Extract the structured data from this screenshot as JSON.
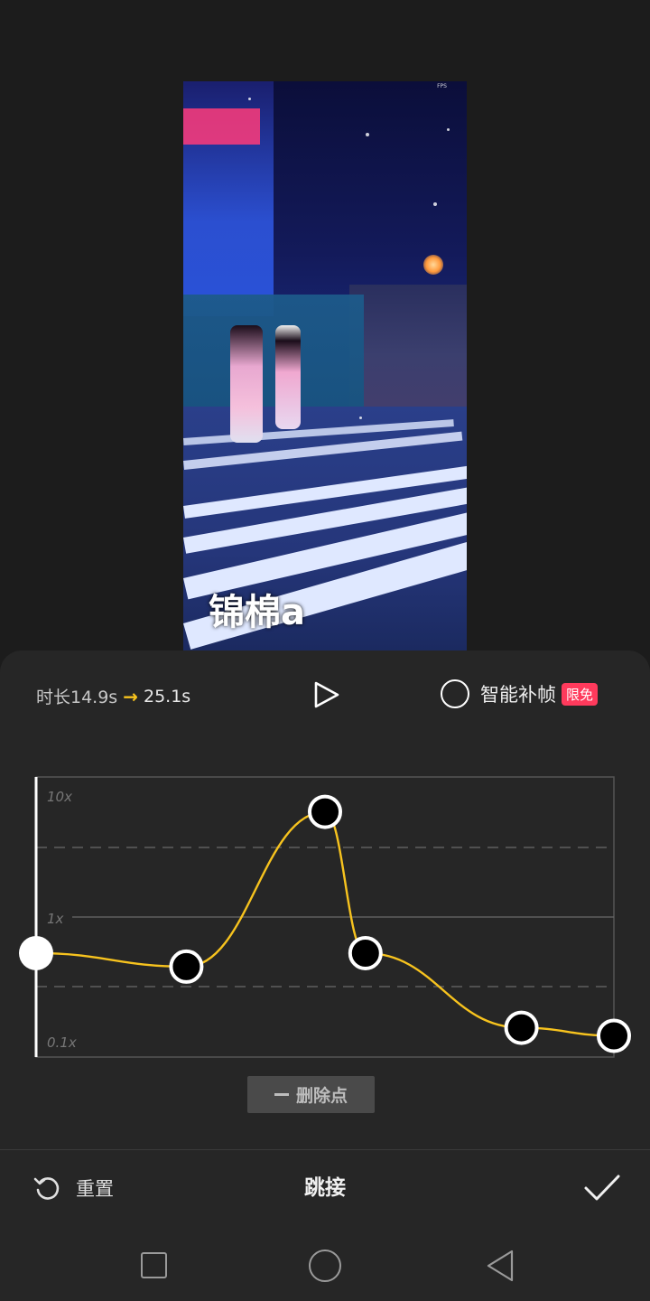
{
  "preview": {
    "watermark": "锦棉a",
    "fps_label": "FPS"
  },
  "header": {
    "duration_label": "时长14.9s",
    "duration_arrow": "→",
    "duration_after": "25.1s",
    "smart_label": "智能补帧",
    "badge": "限免"
  },
  "curve": {
    "y_labels": [
      "10x",
      "1x",
      "0.1x"
    ],
    "points": [
      {
        "t": 0.0,
        "speed": 0.55,
        "selected": true
      },
      {
        "t": 0.26,
        "speed": 0.44
      },
      {
        "t": 0.5,
        "speed": 5.7
      },
      {
        "t": 0.57,
        "speed": 0.55
      },
      {
        "t": 0.84,
        "speed": 0.16
      },
      {
        "t": 1.0,
        "speed": 0.14
      }
    ],
    "curve_color": "#f7c31e"
  },
  "actions": {
    "delete_label": "删除点",
    "reset_label": "重置",
    "title": "跳接"
  }
}
